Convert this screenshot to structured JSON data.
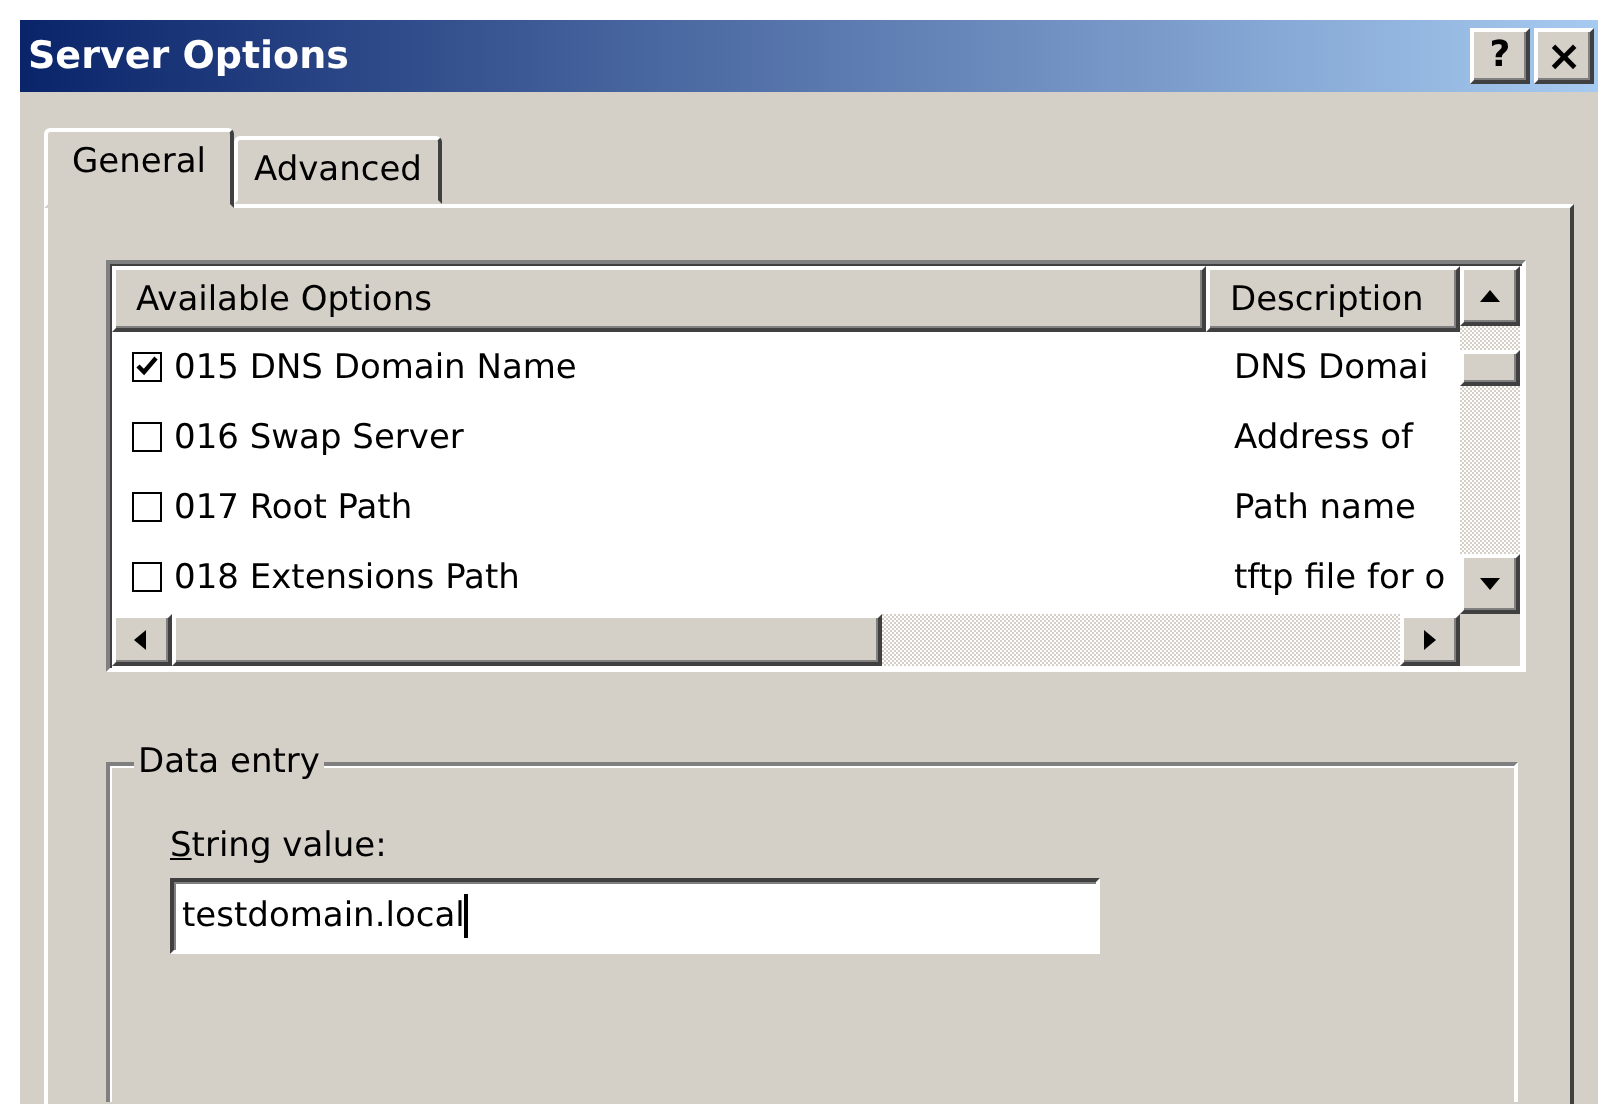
{
  "window": {
    "title": "Server Options",
    "buttons": [
      {
        "kind": "help",
        "label": "?"
      },
      {
        "kind": "close",
        "label": "×"
      }
    ]
  },
  "tabs": [
    {
      "label": "General",
      "selected": true
    },
    {
      "label": "Advanced",
      "selected": false
    }
  ],
  "options": {
    "columns": [
      "Available Options",
      "Description"
    ],
    "rows": [
      {
        "name": "015 DNS Domain Name",
        "description": "DNS Domai",
        "checked": true
      },
      {
        "name": "016 Swap Server",
        "description": "Address of",
        "checked": false
      },
      {
        "name": "017 Root Path",
        "description": "Path name",
        "checked": false
      },
      {
        "name": "018 Extensions Path",
        "description": "tftp file for o",
        "checked": false
      }
    ]
  },
  "data_entry": {
    "title": "Data entry",
    "label": "String value:",
    "value": "testdomain.local"
  }
}
